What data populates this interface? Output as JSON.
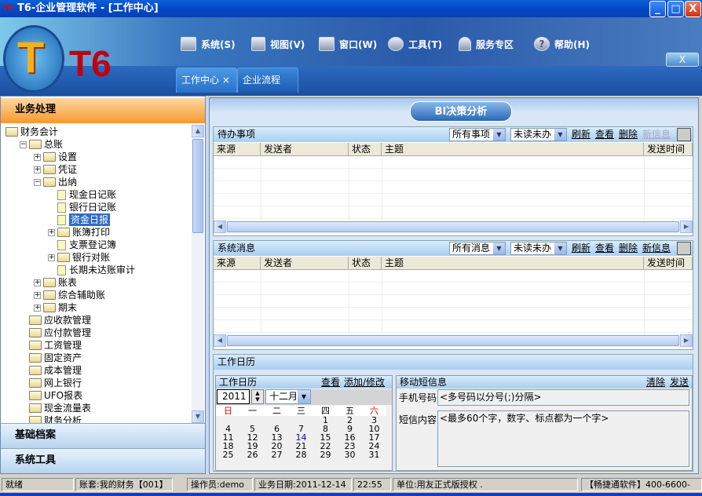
{
  "window": {
    "title": "T6-企业管理软件 - [工作中心]",
    "icon": "T6",
    "min": "_",
    "max": "□",
    "close": "X"
  },
  "header": {
    "logo_text": "T6",
    "menu": [
      {
        "label": "系统(S)",
        "icon": "monitor-icon"
      },
      {
        "label": "视图(V)",
        "icon": "grid-icon"
      },
      {
        "label": "窗口(W)",
        "icon": "window-icon"
      },
      {
        "label": "工具(T)",
        "icon": "gear-icon"
      },
      {
        "label": "服务专区",
        "icon": "user-icon"
      },
      {
        "label": "帮助(H)",
        "icon": "help-icon"
      }
    ],
    "close": "X",
    "tabs": [
      {
        "label": "工作中心",
        "close": "×"
      },
      {
        "label": "企业流程"
      }
    ]
  },
  "left": {
    "header": "业务处理",
    "sections": [
      "基础档案",
      "系统工具"
    ],
    "tree": [
      {
        "label": "财务会计",
        "level": 0,
        "type": "folder",
        "exp": ""
      },
      {
        "label": "总账",
        "level": 1,
        "type": "folder",
        "exp": "-"
      },
      {
        "label": "设置",
        "level": 2,
        "type": "folder",
        "exp": "+"
      },
      {
        "label": "凭证",
        "level": 2,
        "type": "folder",
        "exp": "+"
      },
      {
        "label": "出纳",
        "level": 2,
        "type": "folder",
        "exp": "-"
      },
      {
        "label": "现金日记账",
        "level": 3,
        "type": "doc",
        "exp": ""
      },
      {
        "label": "银行日记账",
        "level": 3,
        "type": "doc",
        "exp": ""
      },
      {
        "label": "资金日报",
        "level": 3,
        "type": "doc",
        "exp": "",
        "selected": true
      },
      {
        "label": "账簿打印",
        "level": 3,
        "type": "folder",
        "exp": "+"
      },
      {
        "label": "支票登记簿",
        "level": 3,
        "type": "doc",
        "exp": ""
      },
      {
        "label": "银行对账",
        "level": 3,
        "type": "folder",
        "exp": "+"
      },
      {
        "label": "长期未达账审计",
        "level": 3,
        "type": "doc",
        "exp": ""
      },
      {
        "label": "账表",
        "level": 2,
        "type": "folder",
        "exp": "+"
      },
      {
        "label": "综合辅助账",
        "level": 2,
        "type": "folder",
        "exp": "+"
      },
      {
        "label": "期末",
        "level": 2,
        "type": "folder",
        "exp": "+"
      },
      {
        "label": "应收款管理",
        "level": 1,
        "type": "folder",
        "exp": ""
      },
      {
        "label": "应付款管理",
        "level": 1,
        "type": "folder",
        "exp": ""
      },
      {
        "label": "工资管理",
        "level": 1,
        "type": "folder",
        "exp": ""
      },
      {
        "label": "固定资产",
        "level": 1,
        "type": "folder",
        "exp": ""
      },
      {
        "label": "成本管理",
        "level": 1,
        "type": "folder",
        "exp": ""
      },
      {
        "label": "网上银行",
        "level": 1,
        "type": "folder",
        "exp": ""
      },
      {
        "label": "UFO报表",
        "level": 1,
        "type": "folder",
        "exp": ""
      },
      {
        "label": "现金流量表",
        "level": 1,
        "type": "folder",
        "exp": ""
      },
      {
        "label": "财务分析",
        "level": 1,
        "type": "folder",
        "exp": ""
      }
    ]
  },
  "main": {
    "bi_tab": "BI决策分析",
    "todo": {
      "title": "待办事项",
      "filter1": "所有事项",
      "filter2": "未读未办",
      "links": [
        "刷新",
        "查看",
        "删除",
        "新信息"
      ],
      "columns": [
        "来源",
        "发送者",
        "状态",
        "主题",
        "发送时间"
      ]
    },
    "messages": {
      "title": "系统消息",
      "filter1": "所有消息",
      "filter2": "未读未办",
      "links": [
        "刷新",
        "查看",
        "删除",
        "新信息"
      ],
      "columns": [
        "来源",
        "发送者",
        "状态",
        "主题",
        "发送时间"
      ]
    },
    "calendar": {
      "title": "工作日历",
      "sub_title": "工作日历",
      "view": "查看",
      "edit": "添加/修改",
      "year": "2011",
      "month": "十二月",
      "weekdays": [
        "日",
        "一",
        "二",
        "三",
        "四",
        "五",
        "六"
      ],
      "today": "14",
      "weeks": [
        [
          "",
          "",
          "",
          "",
          "1",
          "2",
          "3"
        ],
        [
          "4",
          "5",
          "6",
          "7",
          "8",
          "9",
          "10"
        ],
        [
          "11",
          "12",
          "13",
          "14",
          "15",
          "16",
          "17"
        ],
        [
          "18",
          "19",
          "20",
          "21",
          "22",
          "23",
          "24"
        ],
        [
          "25",
          "26",
          "27",
          "28",
          "29",
          "30",
          "31"
        ]
      ]
    },
    "sms": {
      "title": "移动短信息",
      "clear": "清除",
      "send": "发送",
      "phone_label": "手机号码",
      "phone_placeholder": "<多号码以分号(;)分隔>",
      "content_label": "短信内容",
      "content_placeholder": "<最多60个字，数字、标点都为一个字>"
    }
  },
  "status": [
    "就绪",
    "账套:我的财务【001】",
    "操作员:demo",
    "业务日期:2011-12-14",
    "22:55",
    "单位:用友正式版授权  .",
    "【畅捷通软件】400-6600-"
  ]
}
